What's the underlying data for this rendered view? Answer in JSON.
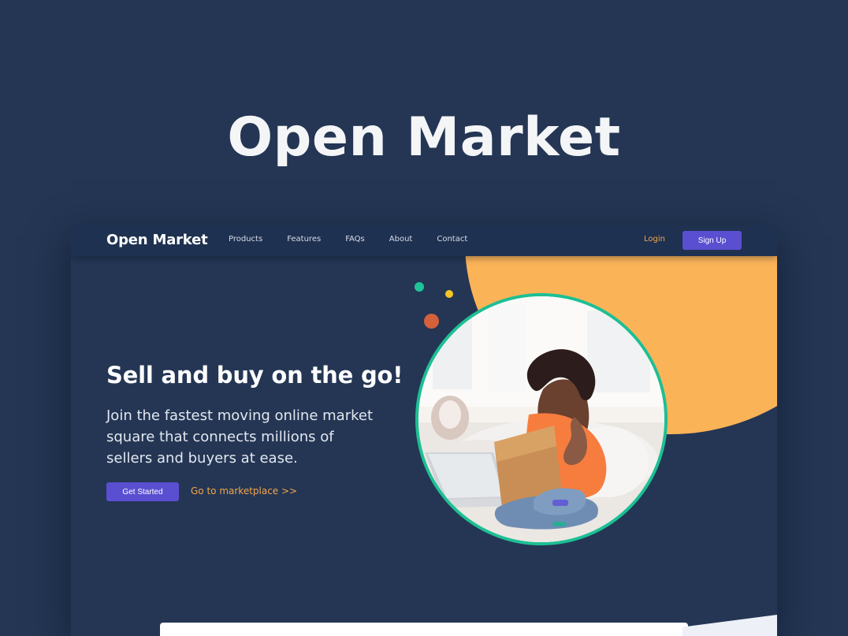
{
  "showcase": {
    "title": "Open Market"
  },
  "nav": {
    "brand": "Open Market",
    "links": [
      {
        "label": "Products"
      },
      {
        "label": "Features"
      },
      {
        "label": "FAQs"
      },
      {
        "label": "About"
      },
      {
        "label": "Contact"
      }
    ],
    "login_label": "Login",
    "signup_label": "Sign Up"
  },
  "hero": {
    "headline": "Sell and buy on the go!",
    "subtext": "Join the fastest moving online market square that connects millions of sellers and buyers at ease.",
    "primary_button": "Get Started",
    "secondary_link": "Go to marketplace >>"
  },
  "colors": {
    "background": "#243654",
    "nav_background": "#1f3150",
    "accent_purple": "#5a4fd1",
    "accent_orange": "#fbb358",
    "accent_teal": "#1dbf94",
    "accent_yellow": "#f6c624",
    "accent_red": "#d5603c",
    "link_orange": "#f3a54a"
  }
}
